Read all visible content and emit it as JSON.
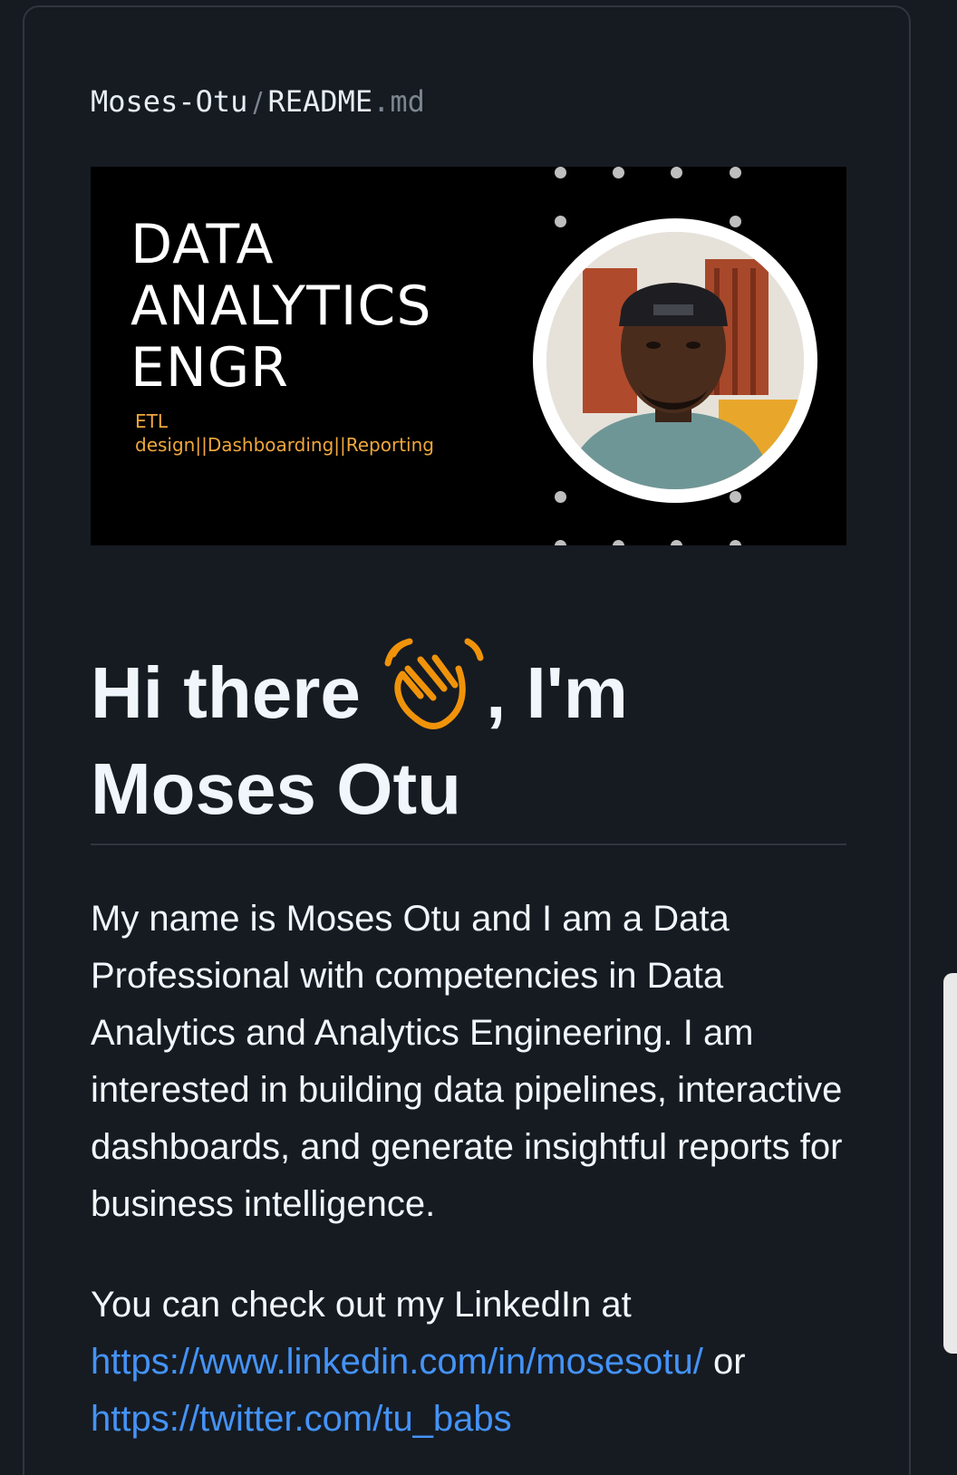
{
  "breadcrumb": {
    "owner": "Moses-Otu",
    "separator": "/",
    "file_name": "README",
    "file_ext": ".md"
  },
  "banner": {
    "line1": "DATA",
    "line2": "ANALYTICS",
    "line3": "ENGR",
    "sub1": "ETL",
    "sub2": "design||Dashboarding||Reporting",
    "accent_color": "#f0a73c"
  },
  "heading": {
    "part1": "Hi there ",
    "emoji": "waving-hand",
    "part2": ", I'm Moses Otu"
  },
  "bio": {
    "text": "My name is Moses Otu and I am a Data Professional with competencies in Data Analytics and Analytics Engineering. I am interested in building data pipelines, interactive dashboards, and generate insightful reports for business intelligence."
  },
  "social": {
    "intro": "You can check out my LinkedIn at",
    "linkedin_url": "https://www.linkedin.com/in/mosesotu/",
    "connector": " or",
    "twitter_url": "https://twitter.com/tu_babs"
  },
  "colors": {
    "background": "#161b22",
    "link": "#4493f8",
    "text": "#f0f6fc",
    "muted": "#7d8590"
  }
}
